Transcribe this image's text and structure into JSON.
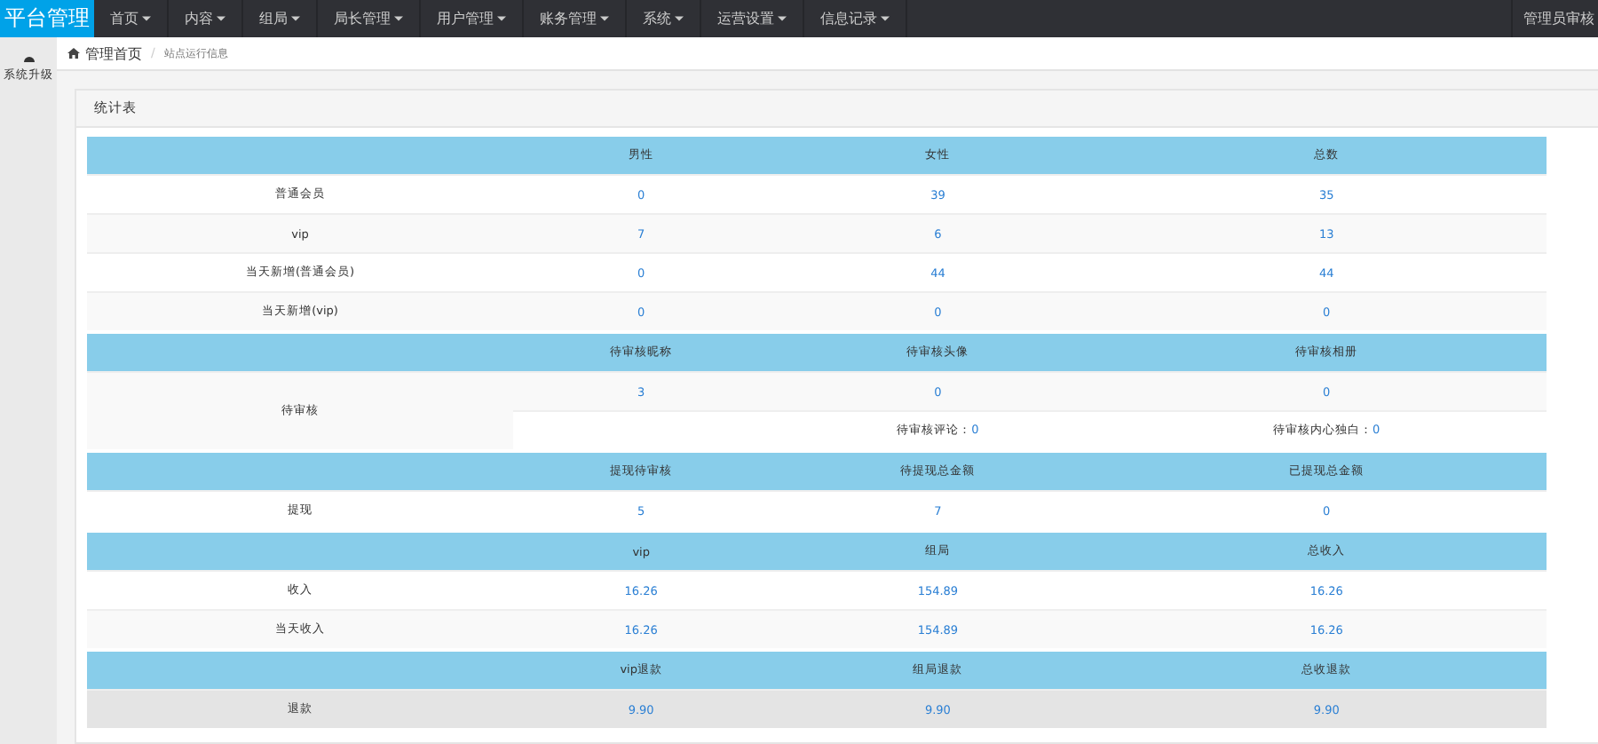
{
  "topbar": {
    "logo": "平台管理",
    "menu": [
      {
        "label": "首页",
        "caret": true
      },
      {
        "label": "内容",
        "caret": true
      },
      {
        "label": "组局",
        "caret": true
      },
      {
        "label": "局长管理",
        "caret": true
      },
      {
        "label": "用户管理",
        "caret": true
      },
      {
        "label": "账务管理",
        "caret": true
      },
      {
        "label": "系统",
        "caret": true
      },
      {
        "label": "运营设置",
        "caret": true
      },
      {
        "label": "信息记录",
        "caret": true
      }
    ],
    "user": "管理员审核"
  },
  "sidebar": {
    "items": [
      {
        "label": "系统升级"
      }
    ]
  },
  "breadcrumb": {
    "home": "管理首页",
    "separator": "/",
    "current": "站点运行信息"
  },
  "panel": {
    "title": "统计表",
    "sections": [
      {
        "columns": [
          "男性",
          "女性",
          "总数"
        ],
        "rows": [
          {
            "label": "普通会员",
            "values": [
              "0",
              "39",
              "35"
            ],
            "highlighted": false
          },
          {
            "label": "vip",
            "values": [
              "7",
              "6",
              "13"
            ],
            "highlighted": false
          },
          {
            "label": "当天新增(普通会员)",
            "values": [
              "0",
              "44",
              "44"
            ],
            "highlighted": false
          },
          {
            "label": "当天新增(vip)",
            "values": [
              "0",
              "0",
              "0"
            ],
            "highlighted": false
          }
        ]
      },
      {
        "columns": [
          "待审核昵称",
          "待审核头像",
          "待审核相册"
        ],
        "rows": [
          {
            "label": "待审核",
            "values": [
              "3",
              "0",
              "0"
            ],
            "highlighted": false,
            "notes": [
              {
                "label": "待审核评论：",
                "value": "0"
              },
              {
                "label": "待审核内心独白：",
                "value": "0"
              }
            ]
          }
        ]
      },
      {
        "columns": [
          "提现待审核",
          "待提现总金额",
          "已提现总金额"
        ],
        "rows": [
          {
            "label": "提现",
            "values": [
              "5",
              "7",
              "0"
            ],
            "highlighted": false
          }
        ]
      },
      {
        "columns": [
          "vip",
          "组局",
          "总收入"
        ],
        "rows": [
          {
            "label": "收入",
            "values": [
              "16.26",
              "154.89",
              "16.26"
            ],
            "highlighted": false
          },
          {
            "label": "当天收入",
            "values": [
              "16.26",
              "154.89",
              "16.26"
            ],
            "highlighted": false
          }
        ]
      },
      {
        "columns": [
          "vip退款",
          "组局退款",
          "总收退款"
        ],
        "rows": [
          {
            "label": "退款",
            "values": [
              "9.90",
              "9.90",
              "9.90"
            ],
            "highlighted": true
          }
        ]
      }
    ]
  }
}
